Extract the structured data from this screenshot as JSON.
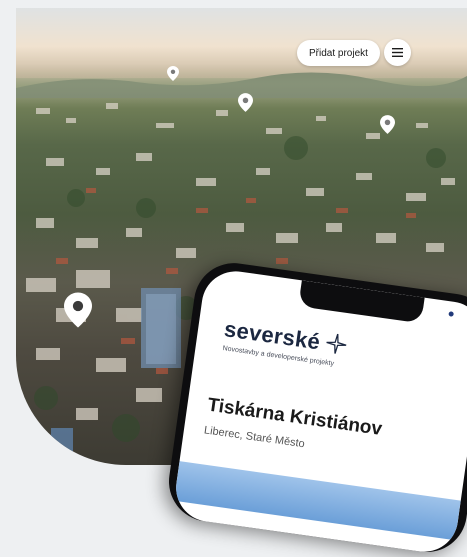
{
  "header": {
    "add_project_label": "Přidat projekt",
    "menu_icon": "hamburger-menu-icon"
  },
  "map": {
    "pins": [
      {
        "icon": "location-pin-icon"
      },
      {
        "icon": "location-pin-icon"
      },
      {
        "icon": "location-pin-icon"
      },
      {
        "icon": "location-pin-icon"
      }
    ]
  },
  "phone": {
    "brand": "severské",
    "brand_tagline": "Novostavby a developerské projekty",
    "project_title": "Tiskárna Kristiánov",
    "project_location": "Liberec, Staré Město"
  },
  "colors": {
    "brand_navy": "#1b2740",
    "pin_white": "#ffffff"
  }
}
